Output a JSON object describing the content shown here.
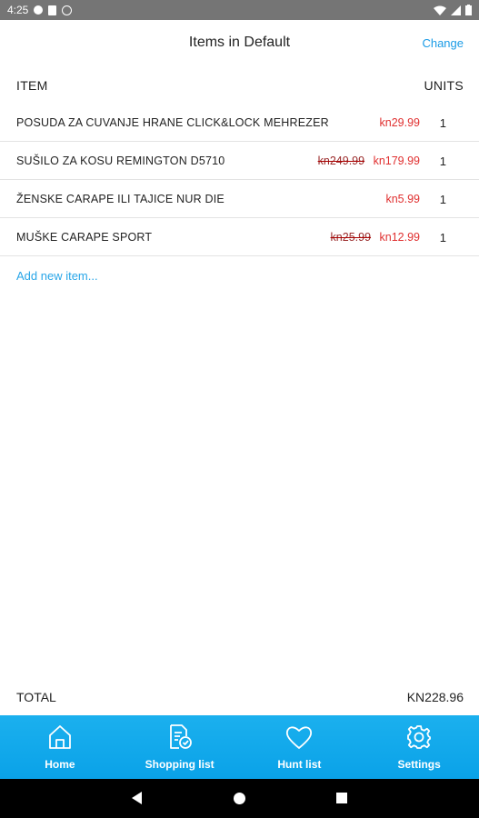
{
  "status_bar": {
    "time": "4:25"
  },
  "header": {
    "title": "Items in Default",
    "action": "Change"
  },
  "table": {
    "col_item": "ITEM",
    "col_units": "UNITS",
    "rows": [
      {
        "name": "POSUDA ZA CUVANJE HRANE CLICK&LOCK MEHREZER",
        "old_price": "",
        "price": "kn29.99",
        "units": "1"
      },
      {
        "name": "SUŠILO ZA KOSU REMINGTON D5710",
        "old_price": "kn249.99",
        "price": "kn179.99",
        "units": "1"
      },
      {
        "name": "ŽENSKE CARAPE ILI TAJICE NUR DIE",
        "old_price": "",
        "price": "kn5.99",
        "units": "1"
      },
      {
        "name": "MUŠKE CARAPE SPORT",
        "old_price": "kn25.99",
        "price": "kn12.99",
        "units": "1"
      }
    ],
    "add_link": "Add new item..."
  },
  "total": {
    "label": "TOTAL",
    "value": "KN228.96"
  },
  "bottom_nav": {
    "items": [
      {
        "label": "Home",
        "icon": "home-icon"
      },
      {
        "label": "Shopping list",
        "icon": "shopping-list-icon"
      },
      {
        "label": "Hunt list",
        "icon": "heart-icon"
      },
      {
        "label": "Settings",
        "icon": "gear-icon"
      }
    ]
  },
  "colors": {
    "accent": "#0aa2e8",
    "price": "#e03030",
    "link": "#29a6e8"
  }
}
